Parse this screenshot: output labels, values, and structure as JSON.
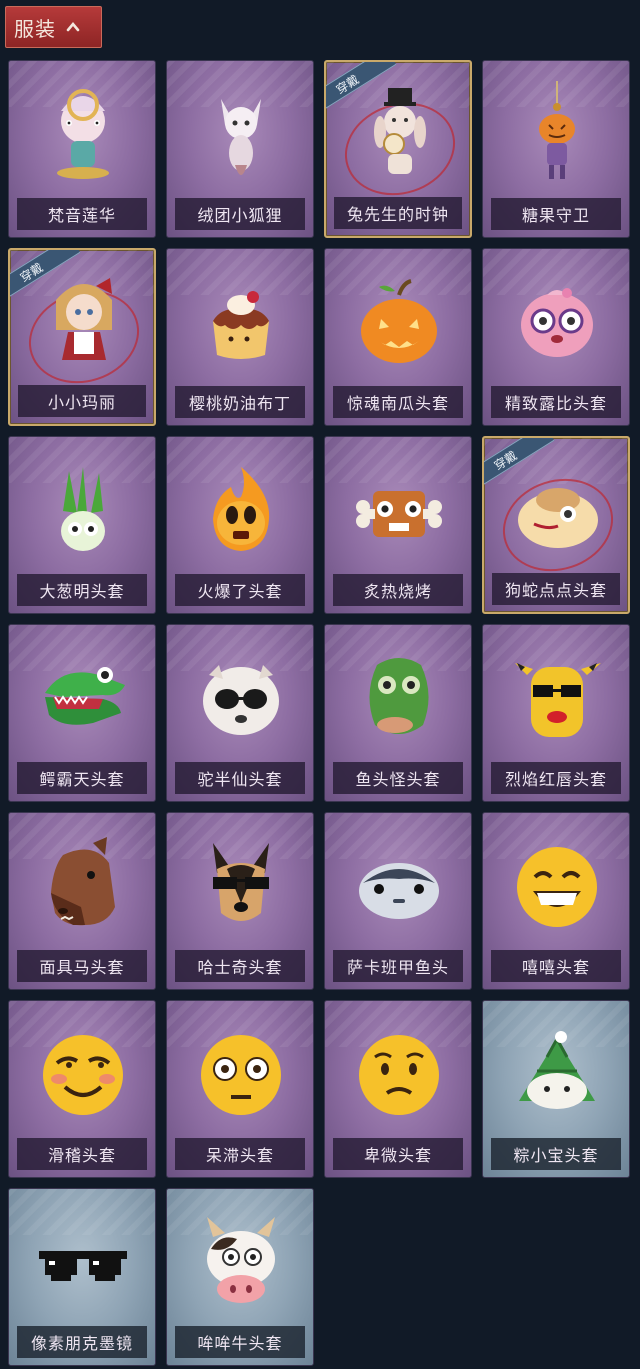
{
  "header": {
    "tab_label": "服装",
    "tab_icon": "chevron-up-icon"
  },
  "colors": {
    "background": "#111a27",
    "tab_red": "#a12f2f",
    "card_purple": "#8d6da2",
    "card_blue": "#8fa4b5",
    "equipped_border": "#c9a96a",
    "badge_blue": "#3a5673"
  },
  "equipped_label": "穿戴",
  "items": [
    {
      "name": "梵音莲华",
      "color": "purple",
      "icon": "lotus-fairy-icon",
      "equipped": false
    },
    {
      "name": "绒团小狐狸",
      "color": "purple",
      "icon": "fox-plush-icon",
      "equipped": false
    },
    {
      "name": "兔先生的时钟",
      "color": "purple",
      "icon": "rabbit-clock-icon",
      "equipped": true
    },
    {
      "name": "糖果守卫",
      "color": "purple",
      "icon": "pumpkin-candy-guard-icon",
      "equipped": false
    },
    {
      "name": "小小玛丽",
      "color": "purple",
      "icon": "little-mary-doll-icon",
      "equipped": true
    },
    {
      "name": "樱桃奶油布丁",
      "color": "purple",
      "icon": "pudding-icon",
      "equipped": false
    },
    {
      "name": "惊魂南瓜头套",
      "color": "purple",
      "icon": "pumpkin-head-icon",
      "equipped": false
    },
    {
      "name": "精致露比头套",
      "color": "purple",
      "icon": "pink-beaver-icon",
      "equipped": false
    },
    {
      "name": "大葱明头套",
      "color": "purple",
      "icon": "green-onion-icon",
      "equipped": false
    },
    {
      "name": "火爆了头套",
      "color": "purple",
      "icon": "fire-face-icon",
      "equipped": false
    },
    {
      "name": "炙热烧烤",
      "color": "purple",
      "icon": "bbq-meat-icon",
      "equipped": false
    },
    {
      "name": "狗蛇点点头套",
      "color": "purple",
      "icon": "dog-snake-icon",
      "equipped": true
    },
    {
      "name": "鳄霸天头套",
      "color": "purple",
      "icon": "crocodile-icon",
      "equipped": false
    },
    {
      "name": "驼半仙头套",
      "color": "purple",
      "icon": "alpaca-sunglasses-icon",
      "equipped": false
    },
    {
      "name": "鱼头怪头套",
      "color": "purple",
      "icon": "fish-head-icon",
      "equipped": false
    },
    {
      "name": "烈焰红唇头套",
      "color": "purple",
      "icon": "yellow-mascot-icon",
      "equipped": false
    },
    {
      "name": "面具马头套",
      "color": "purple",
      "icon": "horse-mask-icon",
      "equipped": false
    },
    {
      "name": "哈士奇头套",
      "color": "purple",
      "icon": "husky-sunglasses-icon",
      "equipped": false
    },
    {
      "name": "萨卡班甲鱼头",
      "color": "purple",
      "icon": "sacabambaspis-icon",
      "equipped": false
    },
    {
      "name": "嘻嘻头套",
      "color": "purple",
      "icon": "grin-emoji-icon",
      "equipped": false
    },
    {
      "name": "滑稽头套",
      "color": "purple",
      "icon": "funny-emoji-icon",
      "equipped": false
    },
    {
      "name": "呆滞头套",
      "color": "purple",
      "icon": "dazed-emoji-icon",
      "equipped": false
    },
    {
      "name": "卑微头套",
      "color": "purple",
      "icon": "humble-emoji-icon",
      "equipped": false
    },
    {
      "name": "粽小宝头套",
      "color": "blue",
      "icon": "zongzi-icon",
      "equipped": false
    },
    {
      "name": "像素朋克墨镜",
      "color": "blue",
      "icon": "pixel-sunglasses-icon",
      "equipped": false
    },
    {
      "name": "哞哞牛头套",
      "color": "blue",
      "icon": "cow-head-icon",
      "equipped": false
    }
  ]
}
